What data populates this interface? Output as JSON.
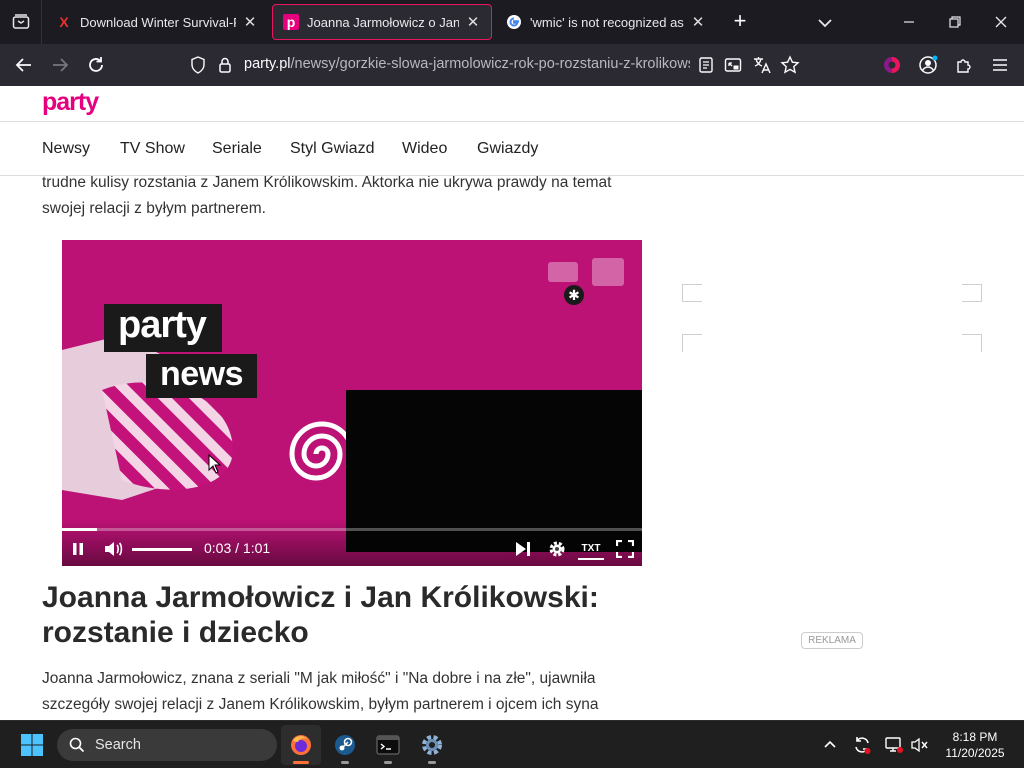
{
  "browser": {
    "tabs": [
      {
        "title": "Download Winter Survival-RUNE",
        "favicon": "X",
        "active": false
      },
      {
        "title": "Joanna Jarmołowicz o Janie Król",
        "favicon": "p",
        "active": true
      },
      {
        "title": "'wmic' is not recognized as an in",
        "favicon": "G",
        "active": false
      }
    ],
    "url_domain": "party.pl",
    "url_path": "/newsy/gorzkie-slowa-jarmolowicz-rok-po-rozstaniu-z-krolikowskim"
  },
  "site": {
    "logo": "party",
    "nav": [
      "Newsy",
      "TV Show",
      "Seriale",
      "Styl Gwiazd",
      "Wideo",
      "Gwiazdy"
    ],
    "intro_line1": "trudne kulisy rozstania z Janem Królikowskim. Aktorka nie ukrywa prawdy na temat",
    "intro_line2": "swojej relacji z byłym partnerem."
  },
  "video": {
    "badge_top": "party",
    "badge_bottom": "news",
    "time": "0:03 / 1:01",
    "progress": 0.06,
    "txt_label": "TXT"
  },
  "article": {
    "heading": "Joanna Jarmołowicz i Jan Królikowski: rozstanie i dziecko",
    "para_line1": "Joanna Jarmołowicz, znana z seriali \"M jak miłość\" i \"Na dobre i na złe\", ujawniła",
    "para_line2": "szczegóły swojej relacji z Janem Królikowskim, byłym partnerem i ojcem ich syna"
  },
  "ad": {
    "label": "REKLAMA"
  },
  "taskbar": {
    "search_label": "Search",
    "time": "8:18 PM",
    "date": "11/20/2025"
  },
  "colors": {
    "brand": "#e6007e",
    "video_bg": "#c3127a",
    "chrome_dark": "#1c1b22"
  }
}
